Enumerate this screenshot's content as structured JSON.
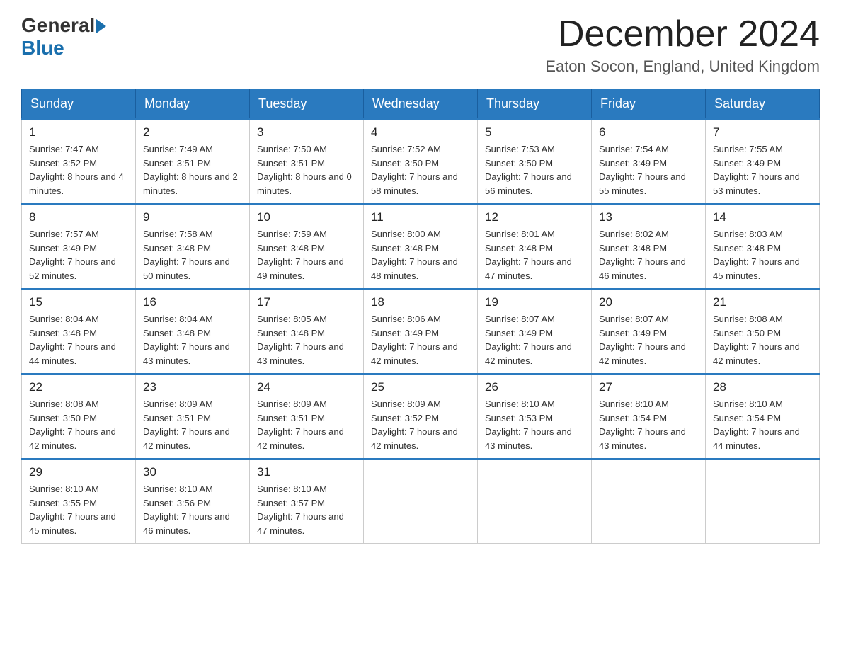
{
  "logo": {
    "general": "General",
    "blue": "Blue"
  },
  "title": "December 2024",
  "location": "Eaton Socon, England, United Kingdom",
  "headers": [
    "Sunday",
    "Monday",
    "Tuesday",
    "Wednesday",
    "Thursday",
    "Friday",
    "Saturday"
  ],
  "weeks": [
    [
      {
        "day": "1",
        "sunrise": "7:47 AM",
        "sunset": "3:52 PM",
        "daylight": "8 hours and 4 minutes."
      },
      {
        "day": "2",
        "sunrise": "7:49 AM",
        "sunset": "3:51 PM",
        "daylight": "8 hours and 2 minutes."
      },
      {
        "day": "3",
        "sunrise": "7:50 AM",
        "sunset": "3:51 PM",
        "daylight": "8 hours and 0 minutes."
      },
      {
        "day": "4",
        "sunrise": "7:52 AM",
        "sunset": "3:50 PM",
        "daylight": "7 hours and 58 minutes."
      },
      {
        "day": "5",
        "sunrise": "7:53 AM",
        "sunset": "3:50 PM",
        "daylight": "7 hours and 56 minutes."
      },
      {
        "day": "6",
        "sunrise": "7:54 AM",
        "sunset": "3:49 PM",
        "daylight": "7 hours and 55 minutes."
      },
      {
        "day": "7",
        "sunrise": "7:55 AM",
        "sunset": "3:49 PM",
        "daylight": "7 hours and 53 minutes."
      }
    ],
    [
      {
        "day": "8",
        "sunrise": "7:57 AM",
        "sunset": "3:49 PM",
        "daylight": "7 hours and 52 minutes."
      },
      {
        "day": "9",
        "sunrise": "7:58 AM",
        "sunset": "3:48 PM",
        "daylight": "7 hours and 50 minutes."
      },
      {
        "day": "10",
        "sunrise": "7:59 AM",
        "sunset": "3:48 PM",
        "daylight": "7 hours and 49 minutes."
      },
      {
        "day": "11",
        "sunrise": "8:00 AM",
        "sunset": "3:48 PM",
        "daylight": "7 hours and 48 minutes."
      },
      {
        "day": "12",
        "sunrise": "8:01 AM",
        "sunset": "3:48 PM",
        "daylight": "7 hours and 47 minutes."
      },
      {
        "day": "13",
        "sunrise": "8:02 AM",
        "sunset": "3:48 PM",
        "daylight": "7 hours and 46 minutes."
      },
      {
        "day": "14",
        "sunrise": "8:03 AM",
        "sunset": "3:48 PM",
        "daylight": "7 hours and 45 minutes."
      }
    ],
    [
      {
        "day": "15",
        "sunrise": "8:04 AM",
        "sunset": "3:48 PM",
        "daylight": "7 hours and 44 minutes."
      },
      {
        "day": "16",
        "sunrise": "8:04 AM",
        "sunset": "3:48 PM",
        "daylight": "7 hours and 43 minutes."
      },
      {
        "day": "17",
        "sunrise": "8:05 AM",
        "sunset": "3:48 PM",
        "daylight": "7 hours and 43 minutes."
      },
      {
        "day": "18",
        "sunrise": "8:06 AM",
        "sunset": "3:49 PM",
        "daylight": "7 hours and 42 minutes."
      },
      {
        "day": "19",
        "sunrise": "8:07 AM",
        "sunset": "3:49 PM",
        "daylight": "7 hours and 42 minutes."
      },
      {
        "day": "20",
        "sunrise": "8:07 AM",
        "sunset": "3:49 PM",
        "daylight": "7 hours and 42 minutes."
      },
      {
        "day": "21",
        "sunrise": "8:08 AM",
        "sunset": "3:50 PM",
        "daylight": "7 hours and 42 minutes."
      }
    ],
    [
      {
        "day": "22",
        "sunrise": "8:08 AM",
        "sunset": "3:50 PM",
        "daylight": "7 hours and 42 minutes."
      },
      {
        "day": "23",
        "sunrise": "8:09 AM",
        "sunset": "3:51 PM",
        "daylight": "7 hours and 42 minutes."
      },
      {
        "day": "24",
        "sunrise": "8:09 AM",
        "sunset": "3:51 PM",
        "daylight": "7 hours and 42 minutes."
      },
      {
        "day": "25",
        "sunrise": "8:09 AM",
        "sunset": "3:52 PM",
        "daylight": "7 hours and 42 minutes."
      },
      {
        "day": "26",
        "sunrise": "8:10 AM",
        "sunset": "3:53 PM",
        "daylight": "7 hours and 43 minutes."
      },
      {
        "day": "27",
        "sunrise": "8:10 AM",
        "sunset": "3:54 PM",
        "daylight": "7 hours and 43 minutes."
      },
      {
        "day": "28",
        "sunrise": "8:10 AM",
        "sunset": "3:54 PM",
        "daylight": "7 hours and 44 minutes."
      }
    ],
    [
      {
        "day": "29",
        "sunrise": "8:10 AM",
        "sunset": "3:55 PM",
        "daylight": "7 hours and 45 minutes."
      },
      {
        "day": "30",
        "sunrise": "8:10 AM",
        "sunset": "3:56 PM",
        "daylight": "7 hours and 46 minutes."
      },
      {
        "day": "31",
        "sunrise": "8:10 AM",
        "sunset": "3:57 PM",
        "daylight": "7 hours and 47 minutes."
      },
      null,
      null,
      null,
      null
    ]
  ]
}
